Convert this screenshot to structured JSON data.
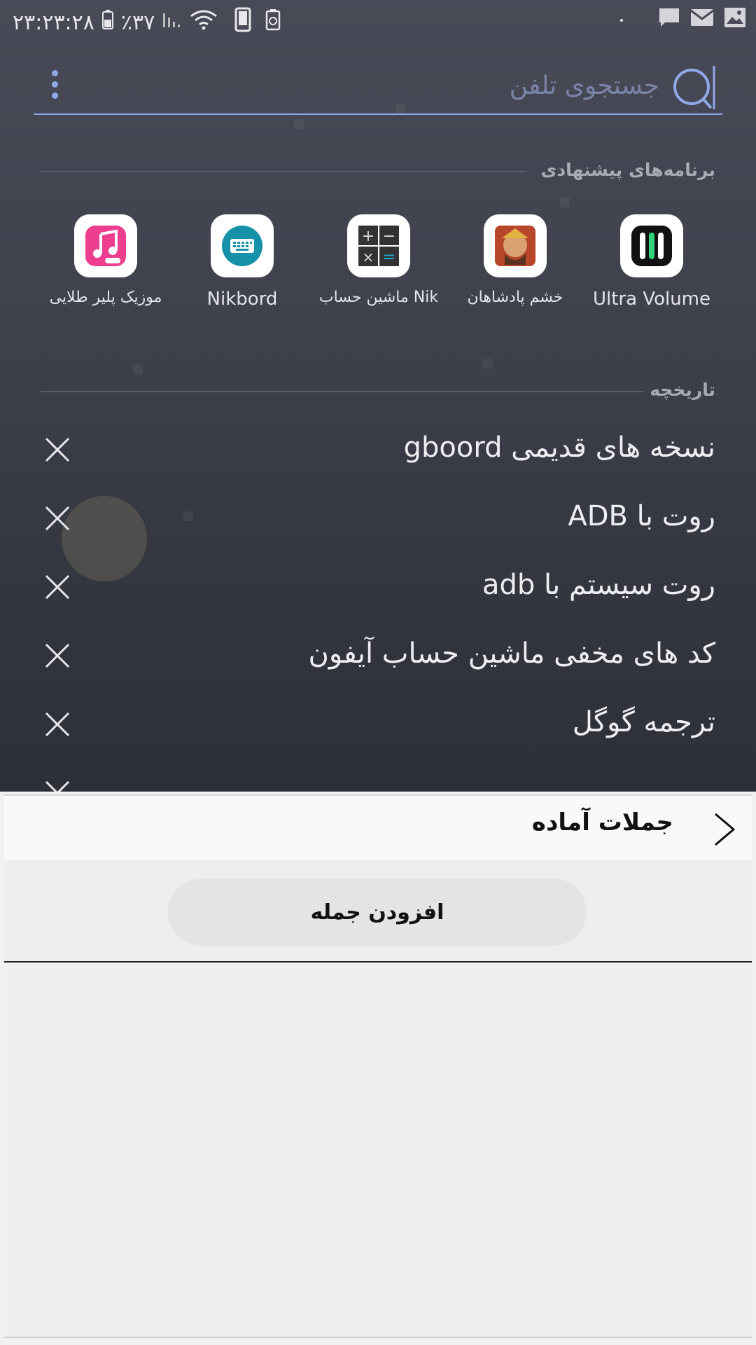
{
  "status_bar": {
    "time": "۲۳:۲۳:۲۸",
    "battery": "٪۳۷"
  },
  "search": {
    "placeholder": "جستجوی تلفن"
  },
  "suggested_apps": {
    "title": "برنامه‌های پیشنهادی",
    "apps": [
      {
        "label": "Ultra Volume",
        "icon": "ultra-volume-icon"
      },
      {
        "label": "خشم پادشاهان",
        "icon": "game-icon"
      },
      {
        "label": "ماشین حساب Nik",
        "icon": "calculator-icon"
      },
      {
        "label": "Nikbord",
        "icon": "keyboard-icon"
      },
      {
        "label": "موزیک پلیر طلایی",
        "icon": "music-icon"
      }
    ]
  },
  "history": {
    "title": "تاریخچه",
    "items": [
      {
        "text": "نسخه های قدیمی gboord"
      },
      {
        "text": "روت با ADB"
      },
      {
        "text": "روت سیستم با adb"
      },
      {
        "text": "کد های مخفی ماشین حساب آیفون"
      },
      {
        "text": "ترجمه گوگل"
      }
    ]
  },
  "panel": {
    "title": "جملات آماده",
    "add_button": "افزودن جمله"
  },
  "colors": {
    "accent": "#8fa8e8",
    "background_top": "#484b57",
    "panel_bg": "#f0f0f2"
  }
}
